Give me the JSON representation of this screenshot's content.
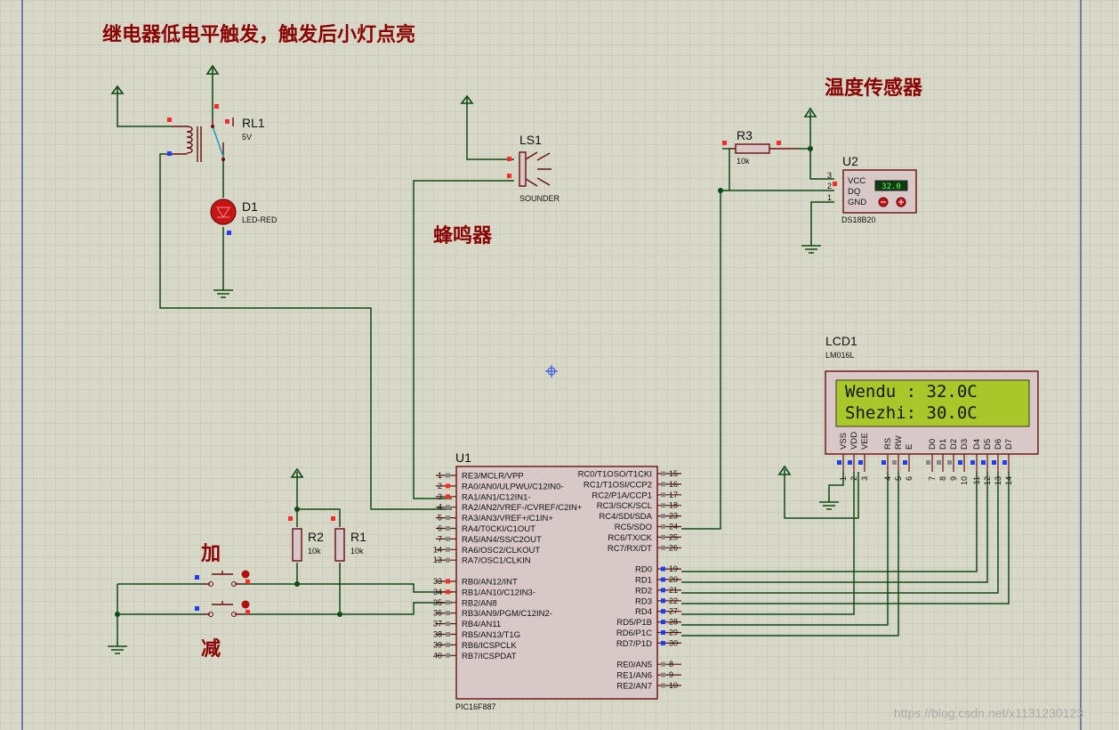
{
  "annotations": {
    "relay_note": "继电器低电平触发，触发后小灯点亮",
    "temp_sensor": "温度传感器",
    "buzzer": "蜂鸣器",
    "add": "加",
    "sub": "减"
  },
  "relay": {
    "ref": "RL1",
    "value": "5V"
  },
  "led": {
    "ref": "D1",
    "value": "LED-RED"
  },
  "sounder": {
    "ref": "LS1",
    "value": "SOUNDER"
  },
  "r3": {
    "ref": "R3",
    "value": "10k"
  },
  "r2": {
    "ref": "R2",
    "value": "10k"
  },
  "r1": {
    "ref": "R1",
    "value": "10k"
  },
  "sensor": {
    "ref": "U2",
    "value": "DS18B20",
    "reading": "32.0",
    "pins": [
      {
        "num": "3",
        "name": "VCC"
      },
      {
        "num": "2",
        "name": "DQ"
      },
      {
        "num": "1",
        "name": "GND"
      }
    ]
  },
  "lcd": {
    "ref": "LCD1",
    "value": "LM016L",
    "line1": "Wendu : 32.0C",
    "line2": "Shezhi: 30.0C",
    "pin_names": [
      "VSS",
      "VDD",
      "VEE",
      "RS",
      "RW",
      "E",
      "D0",
      "D1",
      "D2",
      "D3",
      "D4",
      "D5",
      "D6",
      "D7"
    ],
    "pin_nums": [
      "1",
      "2",
      "3",
      "4",
      "5",
      "6",
      "7",
      "8",
      "9",
      "10",
      "11",
      "12",
      "13",
      "14"
    ]
  },
  "mcu": {
    "ref": "U1",
    "value": "PIC16F887",
    "left_pins": [
      {
        "num": "1",
        "name": "RE3/MCLR/VPP"
      },
      {
        "num": "2",
        "name": "RA0/AN0/ULPWU/C12IN0-"
      },
      {
        "num": "3",
        "name": "RA1/AN1/C12IN1-"
      },
      {
        "num": "4",
        "name": "RA2/AN2/VREF-/CVREF/C2IN+"
      },
      {
        "num": "5",
        "name": "RA3/AN3/VREF+/C1IN+"
      },
      {
        "num": "6",
        "name": "RA4/T0CKI/C1OUT"
      },
      {
        "num": "7",
        "name": "RA5/AN4/SS/C2OUT"
      },
      {
        "num": "14",
        "name": "RA6/OSC2/CLKOUT"
      },
      {
        "num": "13",
        "name": "RA7/OSC1/CLKIN"
      },
      {
        "num": "",
        "name": ""
      },
      {
        "num": "33",
        "name": "RB0/AN12/INT"
      },
      {
        "num": "34",
        "name": "RB1/AN10/C12IN3-"
      },
      {
        "num": "35",
        "name": "RB2/AN8"
      },
      {
        "num": "36",
        "name": "RB3/AN9/PGM/C12IN2-"
      },
      {
        "num": "37",
        "name": "RB4/AN11"
      },
      {
        "num": "38",
        "name": "RB5/AN13/T1G"
      },
      {
        "num": "39",
        "name": "RB6/ICSPCLK"
      },
      {
        "num": "40",
        "name": "RB7/ICSPDAT"
      }
    ],
    "right_pins": [
      {
        "num": "15",
        "name": "RC0/T1OSO/T1CKI"
      },
      {
        "num": "16",
        "name": "RC1/T1OSI/CCP2"
      },
      {
        "num": "17",
        "name": "RC2/P1A/CCP1"
      },
      {
        "num": "18",
        "name": "RC3/SCK/SCL"
      },
      {
        "num": "23",
        "name": "RC4/SDI/SDA"
      },
      {
        "num": "24",
        "name": "RC5/SDO"
      },
      {
        "num": "25",
        "name": "RC6/TX/CK"
      },
      {
        "num": "26",
        "name": "RC7/RX/DT"
      },
      {
        "num": "",
        "name": ""
      },
      {
        "num": "19",
        "name": "RD0"
      },
      {
        "num": "20",
        "name": "RD1"
      },
      {
        "num": "21",
        "name": "RD2"
      },
      {
        "num": "22",
        "name": "RD3"
      },
      {
        "num": "27",
        "name": "RD4"
      },
      {
        "num": "28",
        "name": "RD5/P1B"
      },
      {
        "num": "29",
        "name": "RD6/P1C"
      },
      {
        "num": "30",
        "name": "RD7/P1D"
      },
      {
        "num": "",
        "name": ""
      },
      {
        "num": "8",
        "name": "RE0/AN5"
      },
      {
        "num": "9",
        "name": "RE1/AN6"
      },
      {
        "num": "10",
        "name": "RE2/AN7"
      }
    ]
  },
  "watermark": "https://blog.csdn.net/x1131230123",
  "colors": {
    "background": "#d8d8c8",
    "grid": "#c2c2b0",
    "wire": "#0f4a14",
    "component": "#6a0f0f",
    "annotation": "#8b0000",
    "lcd_screen": "#a9c72a",
    "pin_red": "#ff2a2a",
    "pin_blue": "#1e3cff"
  }
}
